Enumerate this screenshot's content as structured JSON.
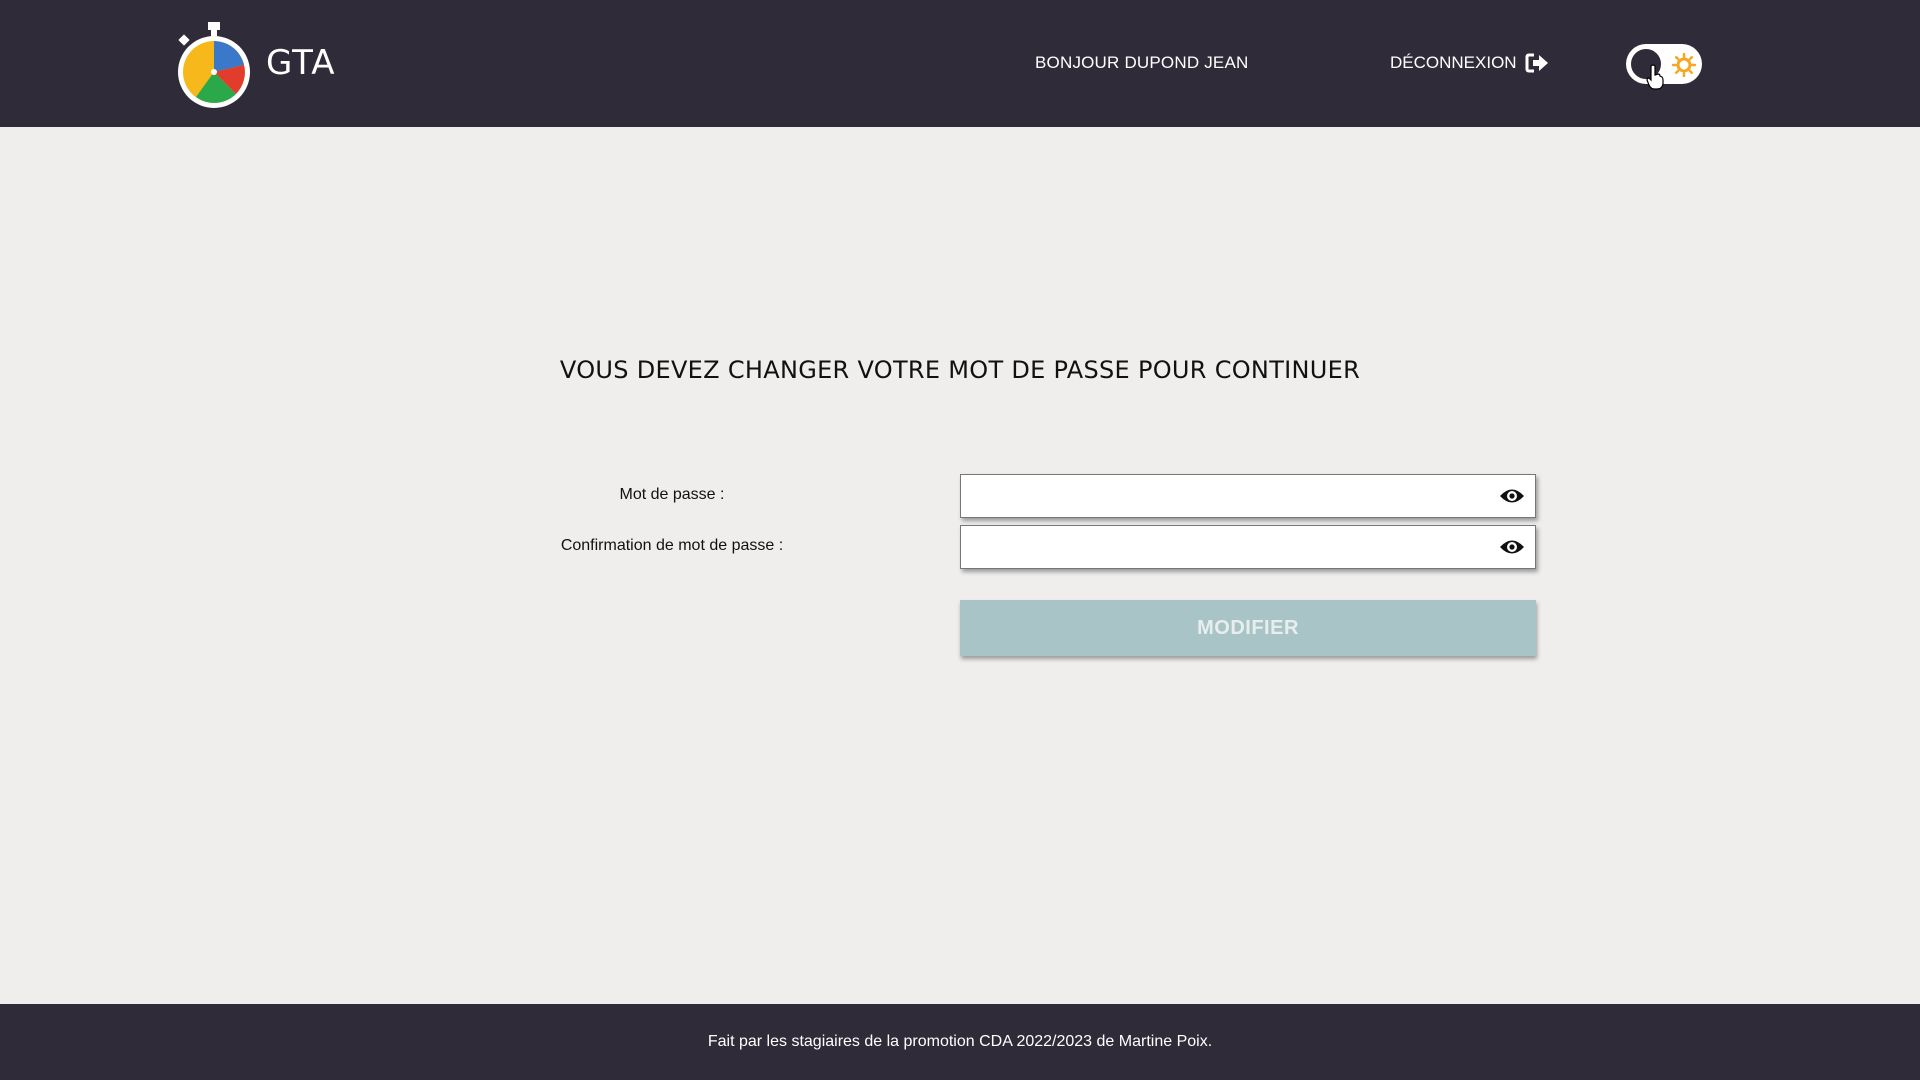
{
  "header": {
    "app_name": "GTA",
    "greeting": "BONJOUR DUPOND JEAN",
    "logout_label": "DÉCONNEXION",
    "theme_toggle": {
      "state": "light",
      "icon": "sun-icon"
    }
  },
  "main": {
    "title": "VOUS DEVEZ CHANGER VOTRE MOT DE PASSE POUR CONTINUER",
    "password_label": "Mot de passe :",
    "password_value": "",
    "confirm_label": "Confirmation de mot de passe :",
    "confirm_value": "",
    "submit_label": "MODIFIER"
  },
  "footer": {
    "text": "Fait par les stagiaires de la promotion CDA 2022/2023 de Martine Poix."
  },
  "colors": {
    "header_bg": "#302b38",
    "page_bg": "#efeeec",
    "button_bg": "#a9c4c6",
    "sun": "#f5a623"
  }
}
